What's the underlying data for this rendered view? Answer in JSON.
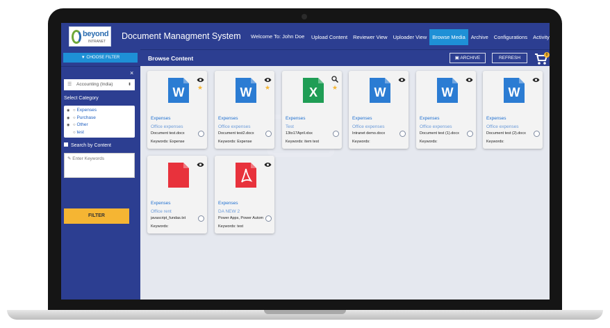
{
  "header": {
    "logo_text": "beyond",
    "logo_sub": "INTRANET",
    "app_title": "Document Managment System",
    "welcome": "Welcome To: John Doe",
    "nav": [
      {
        "label": "Upload Content",
        "active": false
      },
      {
        "label": "Reviewer View",
        "active": false
      },
      {
        "label": "Uploader View",
        "active": false
      },
      {
        "label": "Browse Media",
        "active": true
      },
      {
        "label": "Archive",
        "active": false
      },
      {
        "label": "Configurations",
        "active": false
      },
      {
        "label": "Activity",
        "active": false
      }
    ]
  },
  "sidebar": {
    "choose_filter": "CHOOSE FILTER",
    "close": "×",
    "dropdown_value": "Accounting (India)",
    "select_category_label": "Select Category",
    "categories": [
      "Expenses",
      "Purchase",
      "Other",
      "test"
    ],
    "search_by_content_label": "Search by Content",
    "keywords_placeholder": "Enter Keywords",
    "filter_button": "FILTER"
  },
  "subheader": {
    "title": "Browse Content",
    "archive_label": "ARCHIVE",
    "refresh_label": "REFRESH",
    "cart_count": "0"
  },
  "cards": [
    {
      "type": "word",
      "action": "eye-icon",
      "starred": true,
      "category": "Expenses",
      "subcategory": "Office expenses",
      "file": "Document test.docx",
      "keywords": "Keywords: Expense"
    },
    {
      "type": "word",
      "action": "eye-icon",
      "starred": true,
      "category": "Expenses",
      "subcategory": "Office expenses",
      "file": "Document test2.docx",
      "keywords": "Keywords: Expense"
    },
    {
      "type": "excel",
      "action": "zoom-icon",
      "starred": true,
      "category": "Expenses",
      "subcategory": "Test",
      "file": "13to17April.xlsx",
      "keywords": "Keywords: item test"
    },
    {
      "type": "word",
      "action": "eye-icon",
      "starred": false,
      "category": "Expenses",
      "subcategory": "Office expenses",
      "file": "Intranet demo.docx",
      "keywords": "Keywords:"
    },
    {
      "type": "word",
      "action": "eye-icon",
      "starred": false,
      "category": "Expenses",
      "subcategory": "Office expenses",
      "file": "Document test (1).docx",
      "keywords": "Keywords:"
    },
    {
      "type": "word",
      "action": "eye-icon",
      "starred": false,
      "category": "Expenses",
      "subcategory": "Office expenses",
      "file": "Document test (2).docx",
      "keywords": "Keywords:"
    },
    {
      "type": "file",
      "action": "eye-icon",
      "starred": false,
      "category": "Expenses",
      "subcategory": "Office rent",
      "file": "javascript_fundas.txt",
      "keywords": "Keywords:"
    },
    {
      "type": "pdf",
      "action": "eye-icon",
      "starred": false,
      "category": "Expenses",
      "subcategory": "DA NEW 2",
      "file": "Power Apps, Power Autom",
      "keywords": "Keywords: test"
    }
  ],
  "colors": {
    "navy": "#2c3e91",
    "accent_blue": "#1e90d6",
    "yellow": "#f5b533",
    "word_blue": "#2b7cd3",
    "excel_green": "#1f9d55",
    "red": "#e8323c"
  }
}
